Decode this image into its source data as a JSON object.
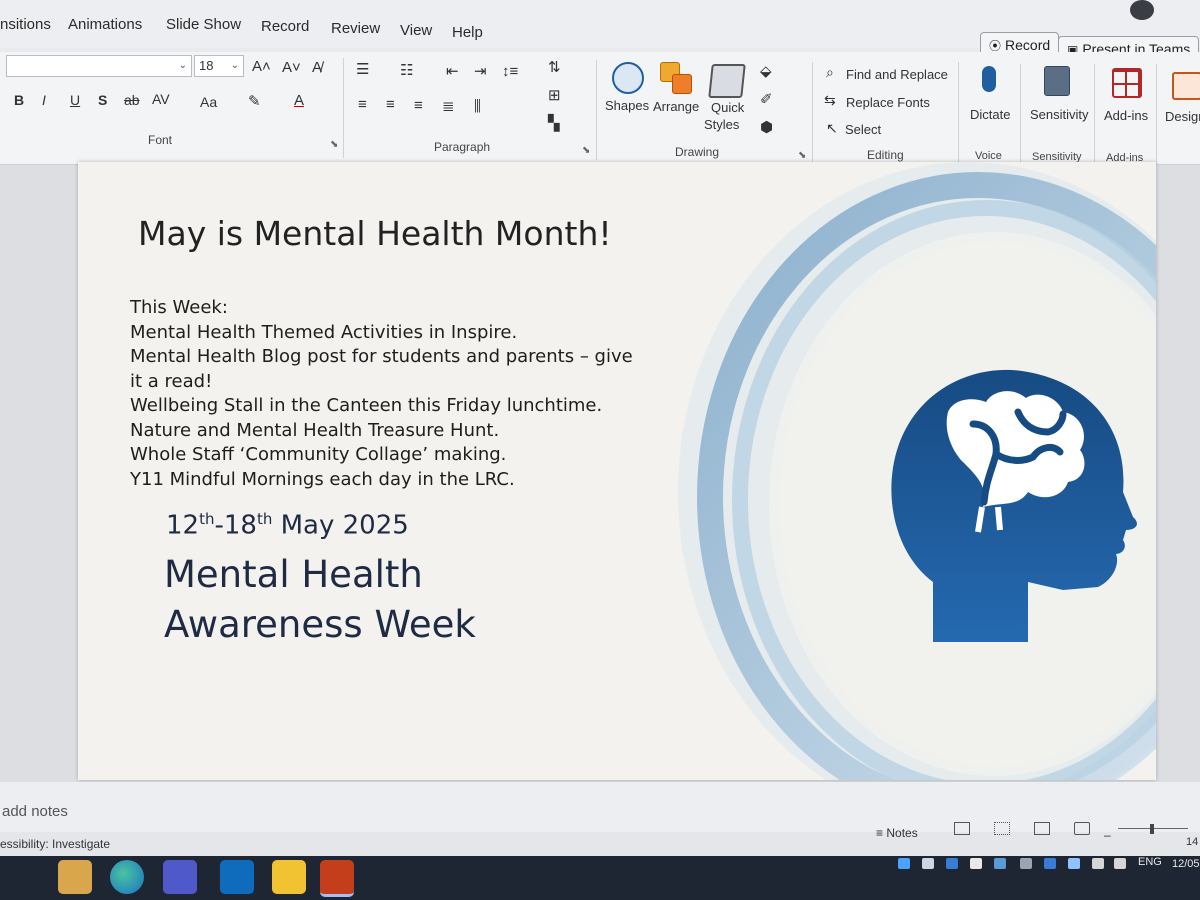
{
  "tabs": [
    "nsitions",
    "Animations",
    "Slide Show",
    "Record",
    "Review",
    "View",
    "Help"
  ],
  "top_buttons": {
    "record": "Record",
    "present_in_teams": "Present in Teams"
  },
  "ribbon": {
    "font": {
      "group_label": "Font",
      "size_value": "18",
      "buttons": [
        "B",
        "I",
        "U",
        "S",
        "ab",
        "AV",
        "Aa"
      ]
    },
    "paragraph": {
      "group_label": "Paragraph"
    },
    "drawing": {
      "group_label": "Drawing",
      "shapes": "Shapes",
      "arrange": "Arrange",
      "quick_styles_1": "Quick",
      "quick_styles_2": "Styles"
    },
    "editing": {
      "group_label": "Editing",
      "find_replace": "Find and Replace",
      "replace_fonts": "Replace Fonts",
      "select": "Select"
    },
    "voice": {
      "group_label": "Voice",
      "dictate": "Dictate"
    },
    "sensitivity": {
      "group_label": "Sensitivity",
      "button": "Sensitivity"
    },
    "addins": {
      "group_label": "Add-ins",
      "button": "Add-ins"
    },
    "designer": {
      "button": "Design"
    }
  },
  "slide": {
    "title": "May is Mental Health Month!",
    "lines": [
      "This Week:",
      "Mental Health Themed Activities in Inspire.",
      "Mental Health Blog post for students and parents – give it a read!",
      "Wellbeing Stall in the Canteen this Friday lunchtime.",
      "Nature and Mental Health Treasure Hunt.",
      "Whole Staff ‘Community Collage’ making.",
      "Y11 Mindful Mornings each day in the LRC."
    ],
    "date": {
      "d1": "12",
      "s1": "th",
      "dash": "-18",
      "s2": "th",
      "rest": " May 2025"
    },
    "heading_1": "Mental Health",
    "heading_2": "Awareness Week",
    "icon": "head-with-brain-icon"
  },
  "notes_placeholder": "add notes",
  "status": {
    "accessibility": "essibility: Investigate",
    "notes_button": "Notes"
  },
  "tray": {
    "language": "ENG",
    "time": "14",
    "date": "12/05"
  },
  "colors": {
    "accent": "#1f5fa0",
    "ribbon": "#f3f4f6",
    "taskbar": "#1f2633"
  }
}
